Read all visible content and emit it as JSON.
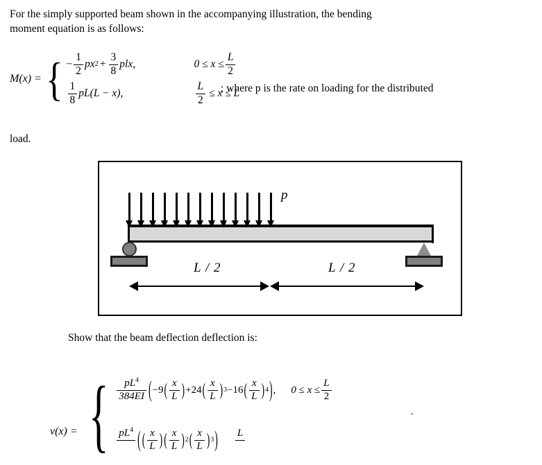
{
  "document": {
    "intro_line1": "For the simply supported beam shown in the accompanying illustration, the bending",
    "intro_line2": "moment equation is as follows:",
    "where_clause": "; where  p  is the rate on loading for the distributed",
    "load_word": "load.",
    "show_line": "Show that the beam deflection deflection is:"
  },
  "moment_equation": {
    "lhs": "M(x) =",
    "branch1": {
      "sign": "−",
      "coef_num": "1",
      "coef_den": "2",
      "term1": "px",
      "term1_exp": "2",
      "plus": "+",
      "coef2_num": "3",
      "coef2_den": "8",
      "term2": "plx,",
      "cond_lower": "0 ≤ x ≤",
      "cond_num": "L",
      "cond_den": "2"
    },
    "branch2": {
      "coef_num": "1",
      "coef_den": "8",
      "term": "pL(L − x),",
      "cond_num": "L",
      "cond_den": "2",
      "cond_rest": "≤ x ≤ L"
    }
  },
  "deflection_equation": {
    "lhs": "v(x) =",
    "branch1": {
      "frac_num_p": "pL",
      "frac_num_exp": "4",
      "frac_den": "384EI",
      "c1": "−9",
      "x_over_L_num": "x",
      "x_over_L_den": "L",
      "c2": "+24",
      "exp2": "3",
      "c3": "−16",
      "exp3": "4",
      "comma": ",",
      "cond_lower": "0 ≤ x ≤",
      "cond_num": "L",
      "cond_den": "2"
    },
    "branch2": {
      "frac_num_p": "pL",
      "frac_num_exp": "4",
      "x_over_L_num": "x",
      "x_over_L_den": "L",
      "exp2": "2",
      "exp3": "3",
      "cond_num": "L"
    },
    "trailing_dot": "."
  },
  "figure": {
    "load_label": "p",
    "dim_left_label": "L / 2",
    "dim_right_label": "L / 2",
    "arrow_count": 13,
    "colors": {
      "beam_fill": "#d8d8d8",
      "support_fill": "#808080",
      "outline": "#000000",
      "page_background": "#ffffff"
    }
  }
}
